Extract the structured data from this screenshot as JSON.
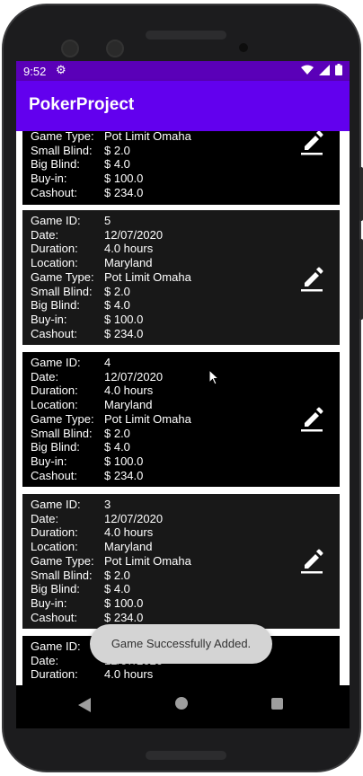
{
  "status_bar": {
    "time": "9:52"
  },
  "app": {
    "title": "PokerProject"
  },
  "labels": {
    "game_id": "Game ID:",
    "date": "Date:",
    "duration": "Duration:",
    "location": "Location:",
    "game_type": "Game Type:",
    "small_blind": "Small Blind:",
    "big_blind": "Big Blind:",
    "buy_in": "Buy-in:",
    "cashout": "Cashout:"
  },
  "games": [
    {
      "game_type": "Pot Limit Omaha",
      "small_blind": "$ 2.0",
      "big_blind": "$ 4.0",
      "buy_in": "$ 100.0",
      "cashout": "$ 234.0"
    },
    {
      "game_id": "5",
      "date": "12/07/2020",
      "duration": "4.0 hours",
      "location": "Maryland",
      "game_type": "Pot Limit Omaha",
      "small_blind": "$ 2.0",
      "big_blind": "$ 4.0",
      "buy_in": "$ 100.0",
      "cashout": "$ 234.0"
    },
    {
      "game_id": "4",
      "date": "12/07/2020",
      "duration": "4.0 hours",
      "location": "Maryland",
      "game_type": "Pot Limit Omaha",
      "small_blind": "$ 2.0",
      "big_blind": "$ 4.0",
      "buy_in": "$ 100.0",
      "cashout": "$ 234.0"
    },
    {
      "game_id": "3",
      "date": "12/07/2020",
      "duration": "4.0 hours",
      "location": "Maryland",
      "game_type": "Pot Limit Omaha",
      "small_blind": "$ 2.0",
      "big_blind": "$ 4.0",
      "buy_in": "$ 100.0",
      "cashout": "$ 234.0"
    },
    {
      "game_id": "",
      "date": "12/07/2020",
      "duration": "4.0 hours"
    }
  ],
  "toast": {
    "message": "Game Successfully Added."
  },
  "icons": {
    "edit": "edit-pencil-icon",
    "settings": "gear-icon",
    "wifi": "wifi-icon",
    "signal": "signal-icon",
    "battery": "battery-icon"
  },
  "colors": {
    "app_bar": "#6200ee",
    "status_bar": "#5a00b8",
    "card_bg": "#000000",
    "list_bg": "#ffffff"
  }
}
